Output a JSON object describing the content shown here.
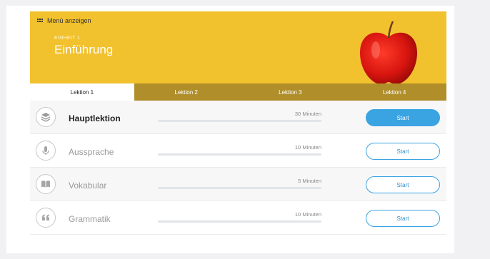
{
  "header": {
    "menu_label": "Menü anzeigen",
    "unit_label": "EINHEIT 1",
    "unit_title": "Einführung"
  },
  "tabs": [
    {
      "label": "Lektion 1",
      "active": true
    },
    {
      "label": "Lektion 2",
      "active": false
    },
    {
      "label": "Lektion 3",
      "active": false
    },
    {
      "label": "Lektion 4",
      "active": false
    }
  ],
  "lessons": [
    {
      "title": "Hauptlektion",
      "duration": "30 Minuten",
      "button": "Start",
      "icon": "layers-icon"
    },
    {
      "title": "Aussprache",
      "duration": "10 Minuten",
      "button": "Start",
      "icon": "microphone-icon"
    },
    {
      "title": "Vokabular",
      "duration": "5 Minuten",
      "button": "Start",
      "icon": "book-icon"
    },
    {
      "title": "Grammatik",
      "duration": "10 Minuten",
      "button": "Start",
      "icon": "quote-icon"
    }
  ],
  "colors": {
    "banner": "#f2c12e",
    "tab_inactive": "#b08f2b",
    "accent": "#3aa3e2"
  }
}
